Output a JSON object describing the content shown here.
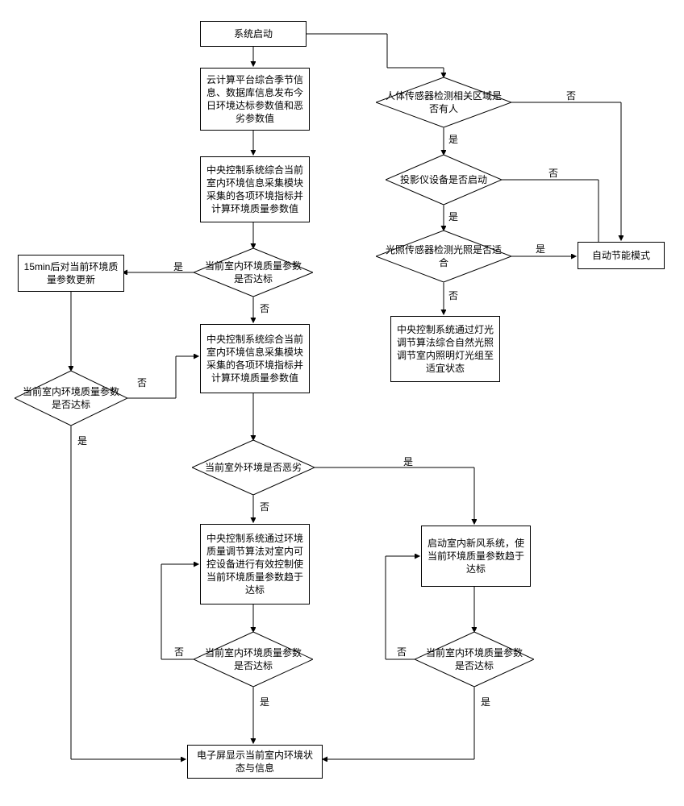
{
  "nodes": {
    "start": "系统启动",
    "cloud": "云计算平台综合季节信息、数据库信息发布今日环境达标参数值和恶劣参数值",
    "central1": "中央控制系统综合当前室内环境信息采集模块采集的各项环境指标并计算环境质量参数值",
    "indoorOk1": "当前室内环境质量参数是否达标",
    "wait15": "15min后对当前环境质量参数更新",
    "indoorOk2": "当前室内环境质量参数是否达标",
    "central2": "中央控制系统综合当前室内环境信息采集模块采集的各项环境指标并计算环境质量参数值",
    "outdoorBad": "当前室外环境是否恶劣",
    "envAdjust": "中央控制系统通过环境质量调节算法对室内可控设备进行有效控制使当前环境质量参数趋于达标",
    "indoorOk3": "当前室内环境质量参数是否达标",
    "freshAir": "启动室内新风系统，使当前环境质量参数趋于达标",
    "indoorOk4": "当前室内环境质量参数是否达标",
    "display": "电子屏显示当前室内环境状态与信息",
    "human": "人体传感器检测相关区域是否有人",
    "projector": "投影仪设备是否启动",
    "lightOk": "光照传感器检测光照是否适合",
    "autoEco": "自动节能模式",
    "lightAdjust": "中央控制系统通过灯光调节算法综合自然光照调节室内照明灯光组至适宜状态"
  },
  "labels": {
    "yes": "是",
    "no": "否"
  },
  "chart_data": {
    "type": "table",
    "description": "Flowchart of indoor environment intelligent control system",
    "nodes": [
      {
        "id": "start",
        "type": "process",
        "text": "系统启动"
      },
      {
        "id": "cloud",
        "type": "process",
        "text": "云计算平台综合季节信息、数据库信息发布今日环境达标参数值和恶劣参数值"
      },
      {
        "id": "central1",
        "type": "process",
        "text": "中央控制系统综合当前室内环境信息采集模块采集的各项环境指标并计算环境质量参数值"
      },
      {
        "id": "indoorOk1",
        "type": "decision",
        "text": "当前室内环境质量参数是否达标"
      },
      {
        "id": "wait15",
        "type": "process",
        "text": "15min后对当前环境质量参数更新"
      },
      {
        "id": "indoorOk2",
        "type": "decision",
        "text": "当前室内环境质量参数是否达标"
      },
      {
        "id": "central2",
        "type": "process",
        "text": "中央控制系统综合当前室内环境信息采集模块采集的各项环境指标并计算环境质量参数值"
      },
      {
        "id": "outdoorBad",
        "type": "decision",
        "text": "当前室外环境是否恶劣"
      },
      {
        "id": "envAdjust",
        "type": "process",
        "text": "中央控制系统通过环境质量调节算法对室内可控设备进行有效控制使当前环境质量参数趋于达标"
      },
      {
        "id": "indoorOk3",
        "type": "decision",
        "text": "当前室内环境质量参数是否达标"
      },
      {
        "id": "freshAir",
        "type": "process",
        "text": "启动室内新风系统，使当前环境质量参数趋于达标"
      },
      {
        "id": "indoorOk4",
        "type": "decision",
        "text": "当前室内环境质量参数是否达标"
      },
      {
        "id": "display",
        "type": "process",
        "text": "电子屏显示当前室内环境状态与信息"
      },
      {
        "id": "human",
        "type": "decision",
        "text": "人体传感器检测相关区域是否有人"
      },
      {
        "id": "projector",
        "type": "decision",
        "text": "投影仪设备是否启动"
      },
      {
        "id": "lightOk",
        "type": "decision",
        "text": "光照传感器检测光照是否适合"
      },
      {
        "id": "autoEco",
        "type": "process",
        "text": "自动节能模式"
      },
      {
        "id": "lightAdjust",
        "type": "process",
        "text": "中央控制系统通过灯光调节算法综合自然光照调节室内照明灯光组至适宜状态"
      }
    ],
    "edges": [
      {
        "from": "start",
        "to": "cloud"
      },
      {
        "from": "start",
        "to": "human"
      },
      {
        "from": "cloud",
        "to": "central1"
      },
      {
        "from": "central1",
        "to": "indoorOk1"
      },
      {
        "from": "indoorOk1",
        "to": "wait15",
        "label": "是"
      },
      {
        "from": "indoorOk1",
        "to": "central2",
        "label": "否"
      },
      {
        "from": "wait15",
        "to": "indoorOk2"
      },
      {
        "from": "indoorOk2",
        "to": "central2",
        "label": "否"
      },
      {
        "from": "indoorOk2",
        "to": "display",
        "label": "是"
      },
      {
        "from": "central2",
        "to": "outdoorBad"
      },
      {
        "from": "outdoorBad",
        "to": "envAdjust",
        "label": "否"
      },
      {
        "from": "outdoorBad",
        "to": "freshAir",
        "label": "是"
      },
      {
        "from": "envAdjust",
        "to": "indoorOk3"
      },
      {
        "from": "indoorOk3",
        "to": "envAdjust",
        "label": "否"
      },
      {
        "from": "indoorOk3",
        "to": "display",
        "label": "是"
      },
      {
        "from": "freshAir",
        "to": "indoorOk4"
      },
      {
        "from": "indoorOk4",
        "to": "freshAir",
        "label": "否"
      },
      {
        "from": "indoorOk4",
        "to": "display",
        "label": "是"
      },
      {
        "from": "human",
        "to": "projector",
        "label": "是"
      },
      {
        "from": "human",
        "to": "autoEco",
        "label": "否"
      },
      {
        "from": "projector",
        "to": "lightOk",
        "label": "是"
      },
      {
        "from": "projector",
        "to": "autoEco",
        "label": "否"
      },
      {
        "from": "lightOk",
        "to": "autoEco",
        "label": "是"
      },
      {
        "from": "lightOk",
        "to": "lightAdjust",
        "label": "否"
      }
    ]
  }
}
